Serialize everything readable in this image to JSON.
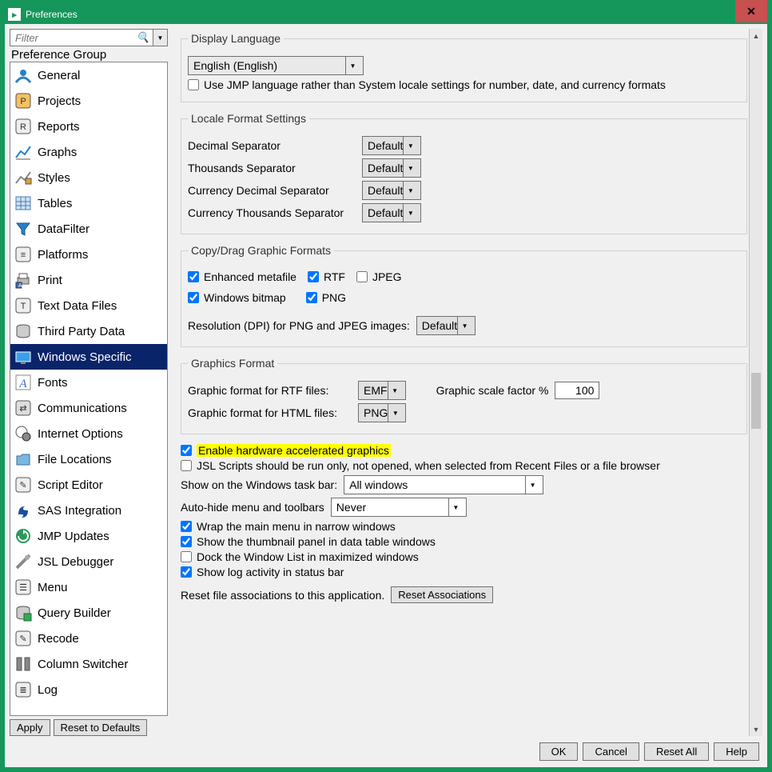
{
  "window": {
    "title": "Preferences",
    "close": "✕"
  },
  "sidebar": {
    "filter_placeholder": "Filter",
    "group_label": "Preference Group",
    "items": [
      {
        "label": "General"
      },
      {
        "label": "Projects"
      },
      {
        "label": "Reports"
      },
      {
        "label": "Graphs"
      },
      {
        "label": "Styles"
      },
      {
        "label": "Tables"
      },
      {
        "label": "DataFilter"
      },
      {
        "label": "Platforms"
      },
      {
        "label": "Print"
      },
      {
        "label": "Text Data Files"
      },
      {
        "label": "Third Party Data"
      },
      {
        "label": "Windows Specific",
        "selected": true
      },
      {
        "label": "Fonts"
      },
      {
        "label": "Communications"
      },
      {
        "label": "Internet Options"
      },
      {
        "label": "File Locations"
      },
      {
        "label": "Script Editor"
      },
      {
        "label": "SAS Integration"
      },
      {
        "label": "JMP Updates"
      },
      {
        "label": "JSL Debugger"
      },
      {
        "label": "Menu"
      },
      {
        "label": "Query Builder"
      },
      {
        "label": "Recode"
      },
      {
        "label": "Column Switcher"
      },
      {
        "label": "Log"
      }
    ],
    "apply": "Apply",
    "reset": "Reset to Defaults"
  },
  "panel": {
    "display_language": {
      "legend": "Display Language",
      "language_value": "English (English)",
      "use_jmp_lang": "Use JMP language rather than System locale settings for number, date, and currency formats",
      "use_jmp_lang_checked": false
    },
    "locale": {
      "legend": "Locale Format Settings",
      "decimal": "Decimal Separator",
      "thousands": "Thousands Separator",
      "curr_dec": "Currency Decimal Separator",
      "curr_thou": "Currency Thousands Separator",
      "default": "Default"
    },
    "copy_drag": {
      "legend": "Copy/Drag Graphic Formats",
      "emf": "Enhanced metafile",
      "emf_checked": true,
      "rtf": "RTF",
      "rtf_checked": true,
      "jpeg": "JPEG",
      "jpeg_checked": false,
      "bmp": "Windows bitmap",
      "bmp_checked": true,
      "png": "PNG",
      "png_checked": true,
      "res_label": "Resolution (DPI) for PNG and JPEG images:",
      "res_value": "Default"
    },
    "graphics": {
      "legend": "Graphics Format",
      "rtf_label": "Graphic format for RTF files:",
      "rtf_value": "EMF",
      "html_label": "Graphic format for HTML files:",
      "html_value": "PNG",
      "scale_label": "Graphic scale factor %",
      "scale_value": "100"
    },
    "misc": {
      "hw_accel": "Enable hardware accelerated graphics",
      "hw_accel_checked": true,
      "jsl_run": "JSL Scripts should be run only, not opened, when selected from Recent Files or a file browser",
      "jsl_run_checked": false,
      "show_taskbar_label": "Show on the Windows task bar:",
      "show_taskbar_value": "All windows",
      "autohide_label": "Auto-hide menu and toolbars",
      "autohide_value": "Never",
      "wrap": "Wrap the main menu in narrow windows",
      "wrap_checked": true,
      "thumb": "Show the thumbnail panel in data table windows",
      "thumb_checked": true,
      "dock": "Dock the Window List in maximized windows",
      "dock_checked": false,
      "log": "Show log activity in status bar",
      "log_checked": true,
      "reset_label": "Reset file associations to this application.",
      "reset_btn": "Reset Associations"
    }
  },
  "footer": {
    "ok": "OK",
    "cancel": "Cancel",
    "reset_all": "Reset All",
    "help": "Help"
  }
}
